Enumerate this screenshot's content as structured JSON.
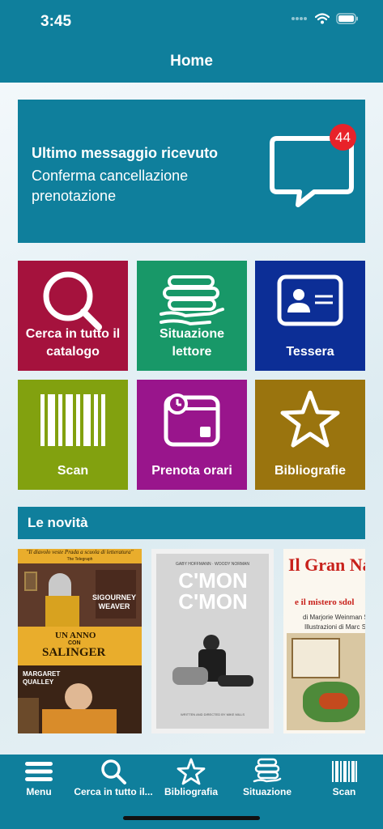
{
  "status_bar": {
    "time": "3:45"
  },
  "nav": {
    "title": "Home"
  },
  "message": {
    "title": "Ultimo messaggio ricevuto",
    "text": "Conferma cancellazione prenotazione",
    "badge_count": "44",
    "icon": "chat-bubble-icon"
  },
  "tiles": [
    {
      "label": "Cerca in tutto il catalogo",
      "icon": "search-icon",
      "color": "#a5123d"
    },
    {
      "label": "Situazione lettore",
      "icon": "books-hand-icon",
      "color": "#189868"
    },
    {
      "label": "Tessera",
      "icon": "id-card-icon",
      "color": "#0c2e96"
    },
    {
      "label": "Scan",
      "icon": "barcode-icon",
      "color": "#82a10f"
    },
    {
      "label": "Prenota orari",
      "icon": "calendar-clock-icon",
      "color": "#99158c"
    },
    {
      "label": "Bibliografie",
      "icon": "star-icon",
      "color": "#9a740e"
    }
  ],
  "news": {
    "title": "Le novità",
    "books": [
      {
        "quote": "\"Il diavolo veste Prada a scuola di letteratura\"",
        "quote_source": "The Telegraph",
        "actor1": "SIGOURNEY WEAVER",
        "title_line1": "UN ANNO",
        "title_line2": "CON",
        "title_line3": "SALINGER",
        "actor2": "MARGARET QUALLEY"
      },
      {
        "names": "GABY HOFFMANN · WOODY NORMAN",
        "title": "C'MON C'MON",
        "credit": "WRITTEN AND DIRECTED BY MIKE MILLS"
      },
      {
        "title": "Il Gran Nata",
        "subtitle": "e il mistero sdol",
        "author": "di Marjorie Weinman S",
        "illustrator": "Illustrazioni di Marc S"
      }
    ]
  },
  "tab_bar": {
    "tabs": [
      {
        "label": "Menu",
        "icon": "menu-icon"
      },
      {
        "label": "Cerca in tutto il...",
        "icon": "search-icon"
      },
      {
        "label": "Bibliografia",
        "icon": "star-icon"
      },
      {
        "label": "Situazione",
        "icon": "books-icon"
      },
      {
        "label": "Scan",
        "icon": "barcode-icon"
      }
    ]
  },
  "colors": {
    "primary": "#0f7f9c",
    "badge": "#e8222a"
  }
}
